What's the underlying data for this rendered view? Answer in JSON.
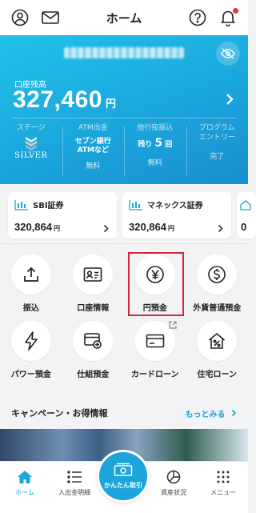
{
  "header": {
    "title": "ホーム"
  },
  "balance": {
    "label": "口座残高",
    "amount": "327,460",
    "unit": "円"
  },
  "stats": [
    {
      "head": "ステージ",
      "badge": "SILVER"
    },
    {
      "head": "ATM出金",
      "line1": "セブン銀行",
      "line2": "ATMなど",
      "foot": "無料"
    },
    {
      "head": "他行宛振込",
      "prefix": "残り",
      "count": "5",
      "suffix": "回",
      "foot": "無料"
    },
    {
      "head1": "プログラム",
      "head2": "エントリー",
      "foot": "完了"
    }
  ],
  "securities": [
    {
      "name": "SBI証券",
      "amount": "320,864",
      "unit": "円"
    },
    {
      "name": "マネックス証券",
      "amount": "320,864",
      "unit": "円"
    },
    {
      "amount": "0"
    }
  ],
  "menu": [
    {
      "label": "振込",
      "icon": "upload-icon"
    },
    {
      "label": "口座情報",
      "icon": "id-card-icon"
    },
    {
      "label": "円預金",
      "icon": "yen-icon"
    },
    {
      "label": "外貨普通預金",
      "icon": "dollar-icon"
    },
    {
      "label": "パワー預金",
      "icon": "lightning-icon"
    },
    {
      "label": "仕組預金",
      "icon": "card-plus-icon"
    },
    {
      "label": "カードローン",
      "icon": "credit-card-icon"
    },
    {
      "label": "住宅ローン",
      "icon": "house-percent-icon"
    }
  ],
  "campaign": {
    "title": "キャンペーン・お得情報",
    "more": "もっとみる"
  },
  "nav": {
    "home": "ホーム",
    "history": "入出金明細",
    "fab": "かんたん取引",
    "assets": "資産状況",
    "menu": "メニュー"
  },
  "colors": {
    "accent": "#1aa6dc",
    "highlight": "#d6243a",
    "notification": "#e8343c"
  }
}
